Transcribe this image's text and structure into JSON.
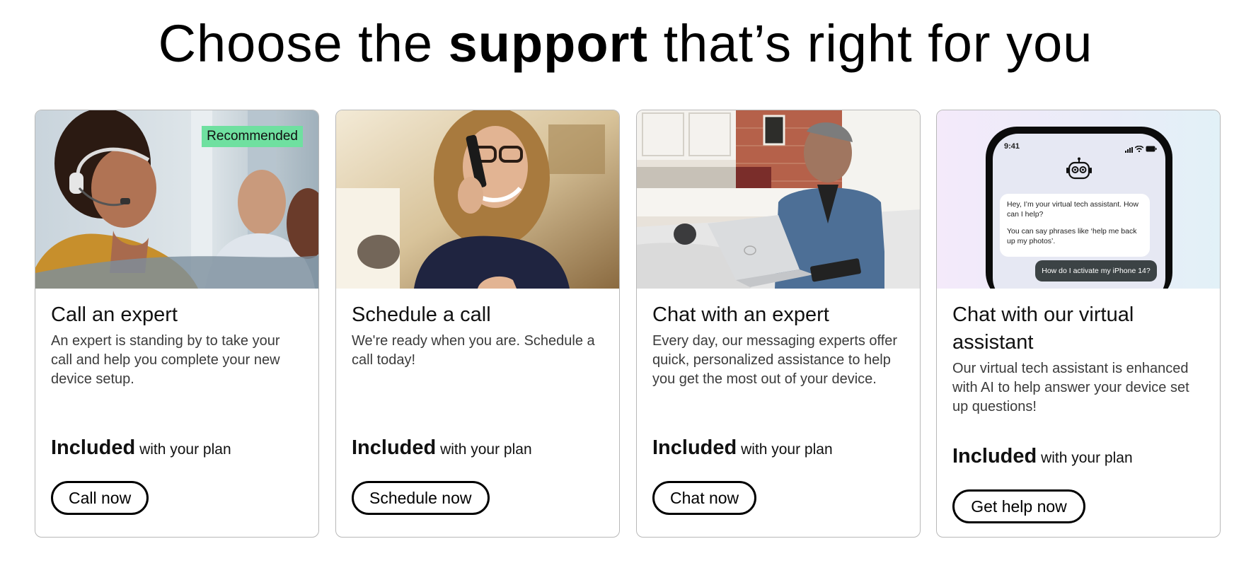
{
  "header": {
    "title_pre": "Choose the ",
    "title_bold": "support",
    "title_post": " that’s right for you"
  },
  "cards": [
    {
      "title": "Call an expert",
      "description": "An expert is standing by to take your call and help you complete your new device setup.",
      "badge": "Recommended",
      "price_bold": "Included",
      "price_rest": " with your plan",
      "button": "Call now"
    },
    {
      "title": "Schedule a call",
      "description": "We're ready when you are. Schedule a call today!",
      "price_bold": "Included",
      "price_rest": " with your plan",
      "button": "Schedule now"
    },
    {
      "title": "Chat with an expert",
      "description": "Every day, our messaging experts offer quick, personalized assistance to help you get the most out of your device.",
      "price_bold": "Included",
      "price_rest": " with your plan",
      "button": "Chat now"
    },
    {
      "title": "Chat with our virtual assistant",
      "description": "Our virtual tech assistant is enhanced with AI to help answer your device set up questions!",
      "price_bold": "Included",
      "price_rest": " with your plan",
      "button": "Get help now",
      "phone": {
        "time": "9:41",
        "bot_message_1": "Hey, I’m your virtual tech assistant. How can I help?",
        "bot_message_2": "You can say phrases like ‘help me back up my photos’.",
        "user_message": "How do I activate my iPhone 14?"
      }
    }
  ],
  "colors": {
    "badge": "#6fe0a0",
    "border": "#b8b8b8",
    "button_border": "#000000"
  }
}
